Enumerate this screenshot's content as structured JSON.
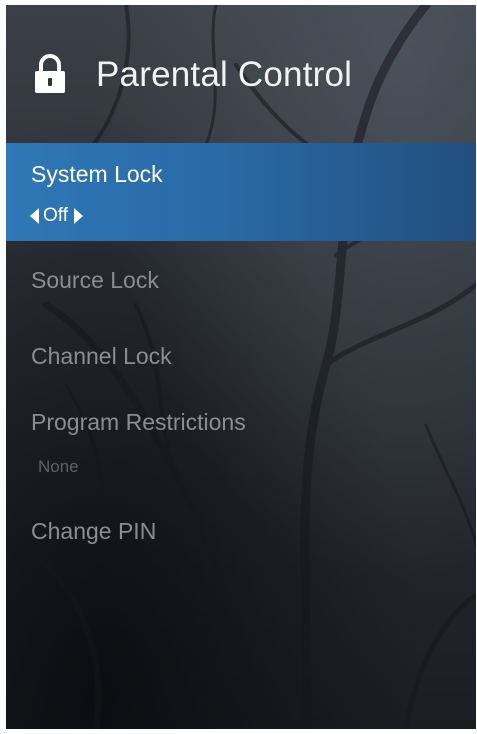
{
  "header": {
    "title": "Parental Control",
    "icon": "lock-icon"
  },
  "menu": {
    "items": [
      {
        "label": "System Lock",
        "value": "Off",
        "selected": true
      },
      {
        "label": "Source Lock"
      },
      {
        "label": "Channel Lock"
      },
      {
        "label": "Program Restrictions",
        "value": "None"
      },
      {
        "label": "Change PIN"
      }
    ]
  },
  "colors": {
    "selected_bg": "#2f77b6",
    "text_primary": "#ffffff",
    "text_dim": "#8a8e94",
    "background": "#2d3138"
  }
}
